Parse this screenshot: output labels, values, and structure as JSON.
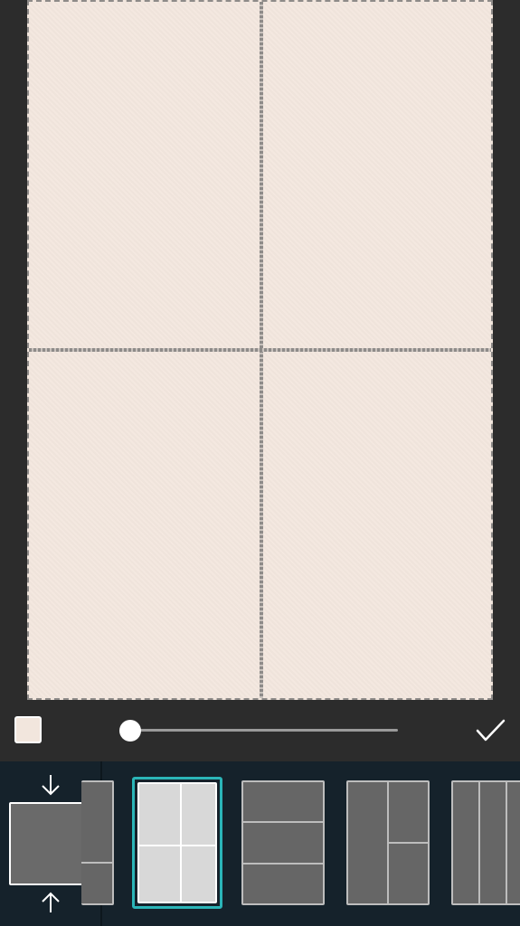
{
  "canvas": {
    "background_color": "#f2e6dd",
    "cells": [
      "cell-top-left",
      "cell-top-right",
      "cell-bottom-left",
      "cell-bottom-right"
    ]
  },
  "controls": {
    "background_swatch_color": "#f2e6dd",
    "border_slider_value": 0,
    "confirm_icon": "check-icon"
  },
  "layout_strip": {
    "size_toggle_icons": [
      "arrow-down-icon",
      "arrow-up-icon"
    ],
    "selected_layout": "grid-2x2",
    "layouts": [
      "partial-split",
      "grid-2x2",
      "rows-3",
      "left-column-right-split",
      "columns-3"
    ],
    "accent_color": "#2bb5b8"
  }
}
